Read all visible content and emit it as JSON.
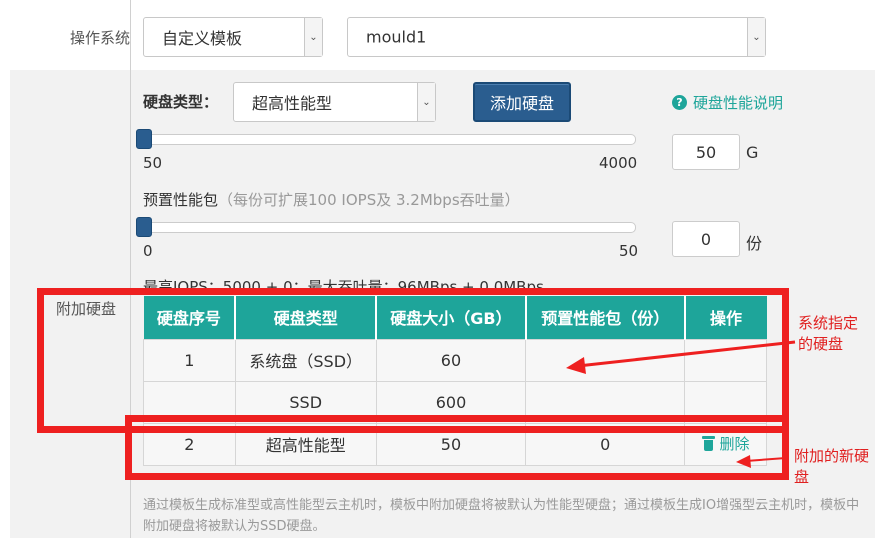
{
  "os_row": {
    "label": "操作系统",
    "template_select": "自定义模板",
    "mould_select": "mould1"
  },
  "disk_type_row": {
    "label": "硬盘类型：",
    "select_value": "超高性能型",
    "add_button": "添加硬盘",
    "help_link": "硬盘性能说明"
  },
  "size_slider": {
    "value_fraction": 0,
    "min_label": "50",
    "max_label": "4000",
    "input_value": "50",
    "unit": "G"
  },
  "perf_pack": {
    "label": "预置性能包",
    "note": "（每份可扩展100 IOPS及 3.2Mbps吞吐量）",
    "value_fraction": 0,
    "min_label": "0",
    "max_label": "50",
    "input_value": "0",
    "unit": "份"
  },
  "iops_info": "最高IOPS：5000 + 0；最大吞吐量：96MBps + 0.0MBps",
  "attached_disk_label": "附加硬盘",
  "table": {
    "headers": [
      "硬盘序号",
      "硬盘类型",
      "硬盘大小（GB）",
      "预置性能包（份）",
      "操作"
    ],
    "rows": [
      [
        "1",
        "系统盘（SSD）",
        "60",
        "",
        ""
      ],
      [
        "",
        "SSD",
        "600",
        "",
        ""
      ],
      [
        "2",
        "超高性能型",
        "50",
        "0",
        "删除"
      ]
    ]
  },
  "annotations": {
    "system_disk": "系统指定的硬盘",
    "new_disk": "附加的新硬盘"
  },
  "footer_note": "通过模板生成标准型或高性能型云主机时，模板中附加硬盘将被默认为性能型硬盘；通过模板生成IO增强型云主机时，模板中附加硬盘将被默认为SSD硬盘。",
  "colors": {
    "accent": "#1ea59a",
    "button": "#2a5d8f",
    "annotation": "#ee2020"
  }
}
